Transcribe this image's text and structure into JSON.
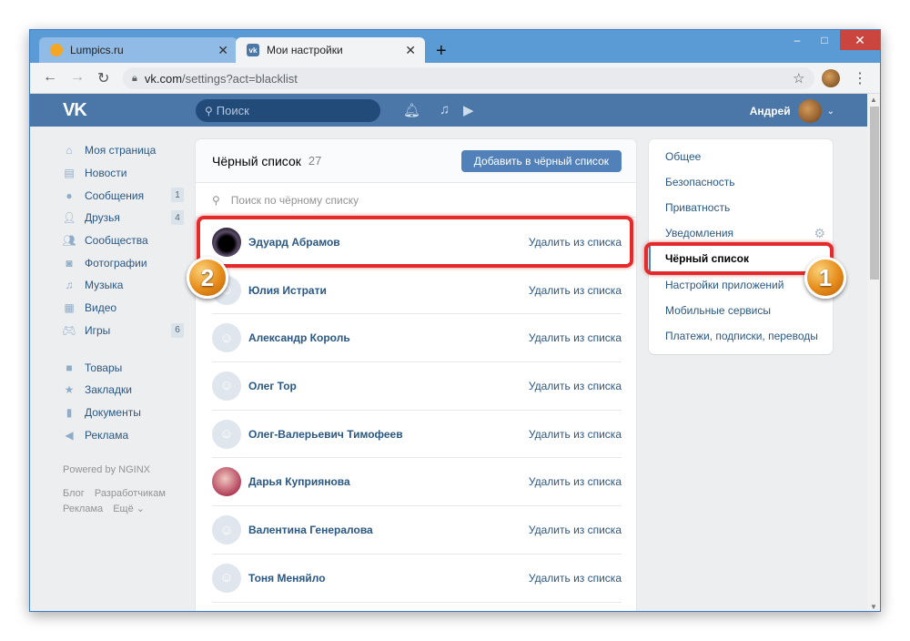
{
  "browser": {
    "tabs": [
      {
        "title": "Lumpics.ru",
        "active": false
      },
      {
        "title": "Мои настройки",
        "active": true
      }
    ],
    "url_host": "vk.com",
    "url_path": "/settings?act=blacklist"
  },
  "vk_header": {
    "logo": "VK",
    "search_placeholder": "Поиск",
    "user_name": "Андрей"
  },
  "left_nav": {
    "items": [
      {
        "label": "Моя страница",
        "icon": "home-icon",
        "badge": ""
      },
      {
        "label": "Новости",
        "icon": "news-icon",
        "badge": ""
      },
      {
        "label": "Сообщения",
        "icon": "message-icon",
        "badge": "1"
      },
      {
        "label": "Друзья",
        "icon": "friends-icon",
        "badge": "4"
      },
      {
        "label": "Сообщества",
        "icon": "communities-icon",
        "badge": ""
      },
      {
        "label": "Фотографии",
        "icon": "camera-icon",
        "badge": ""
      },
      {
        "label": "Музыка",
        "icon": "music-icon",
        "badge": ""
      },
      {
        "label": "Видео",
        "icon": "video-icon",
        "badge": ""
      },
      {
        "label": "Игры",
        "icon": "gamepad-icon",
        "badge": "6"
      }
    ],
    "items2": [
      {
        "label": "Товары",
        "icon": "bag-icon"
      },
      {
        "label": "Закладки",
        "icon": "star-icon"
      },
      {
        "label": "Документы",
        "icon": "document-icon"
      },
      {
        "label": "Реклама",
        "icon": "megaphone-icon"
      }
    ],
    "powered": "Powered by NGINX",
    "footer": [
      "Блог",
      "Разработчикам",
      "Реклама",
      "Ещё ⌄"
    ]
  },
  "blacklist": {
    "title": "Чёрный список",
    "count": "27",
    "add_button": "Добавить в чёрный список",
    "search_placeholder": "Поиск по чёрному списку",
    "remove_label": "Удалить из списка",
    "rows": [
      {
        "name": "Эдуард Абрамов",
        "avatar": "dark"
      },
      {
        "name": "Юлия Истрати",
        "avatar": "default"
      },
      {
        "name": "Александр Король",
        "avatar": "default"
      },
      {
        "name": "Олег Тор",
        "avatar": "default"
      },
      {
        "name": "Олег-Валерьевич Тимофеев",
        "avatar": "default"
      },
      {
        "name": "Дарья Куприянова",
        "avatar": "photo"
      },
      {
        "name": "Валентина Генералова",
        "avatar": "default"
      },
      {
        "name": "Тоня Меняйло",
        "avatar": "default"
      }
    ]
  },
  "settings_menu": {
    "items": [
      {
        "label": "Общее",
        "selected": false
      },
      {
        "label": "Безопасность",
        "selected": false
      },
      {
        "label": "Приватность",
        "selected": false
      },
      {
        "label": "Уведомления",
        "selected": false
      },
      {
        "label": "Чёрный список",
        "selected": true
      },
      {
        "label": "Настройки приложений",
        "selected": false
      },
      {
        "label": "Мобильные сервисы",
        "selected": false
      },
      {
        "label": "Платежи, подписки, переводы",
        "selected": false
      }
    ]
  },
  "annotations": {
    "marker_1": "1",
    "marker_2": "2",
    "highlight_color": "#e32b2b",
    "marker_color": "#e68c1a"
  },
  "colors": {
    "vk_blue": "#4a76a8",
    "link": "#2a5885",
    "button": "#5181b8"
  }
}
